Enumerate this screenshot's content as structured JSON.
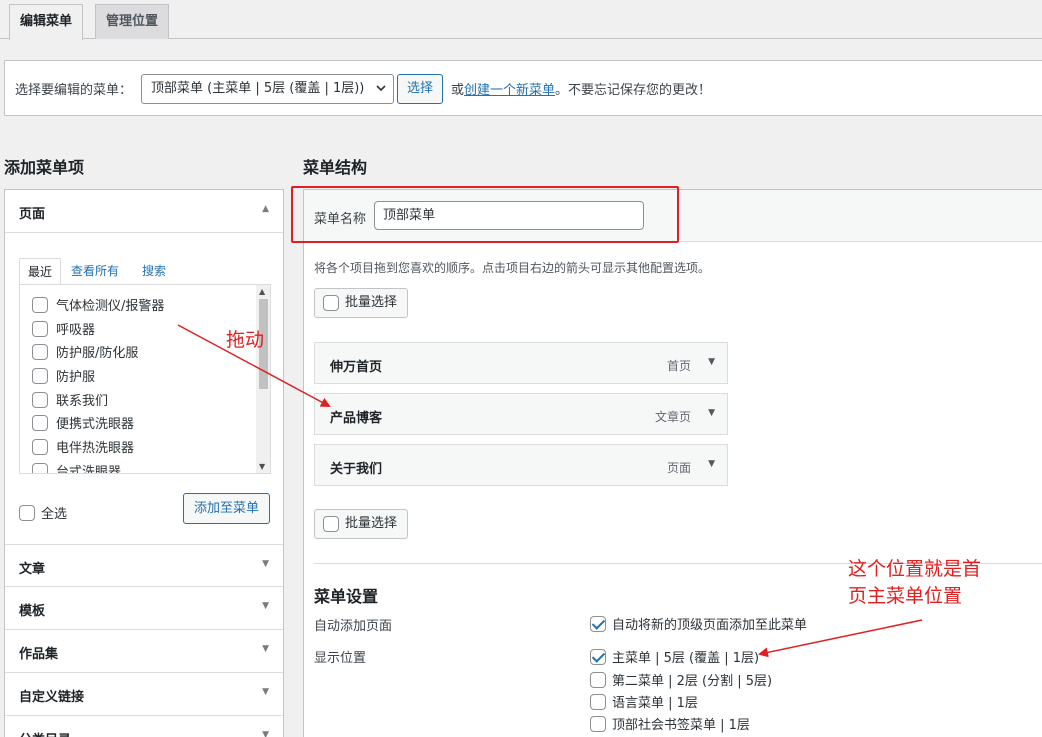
{
  "tabs": [
    {
      "label": "编辑菜单",
      "active": true
    },
    {
      "label": "管理位置",
      "active": false
    }
  ],
  "manage": {
    "label": "选择要编辑的菜单：",
    "selected_menu": "顶部菜单 (主菜单 | 5层 (覆盖 | 1层))",
    "select_button": "选择",
    "note_prefix": "或",
    "note_link": "创建一个新菜单",
    "note_suffix": "。不要忘记保存您的更改！"
  },
  "left": {
    "title": "添加菜单项",
    "pages_section": {
      "title": "页面",
      "subtabs": [
        "最近",
        "查看所有",
        "搜索"
      ],
      "items": [
        "气体检测仪/报警器",
        "呼吸器",
        "防护服/防化服",
        "防护服",
        "联系我们",
        "便携式洗眼器",
        "电伴热洗眼器",
        "台式洗眼器"
      ],
      "select_all": "全选",
      "add_button": "添加至菜单"
    },
    "sections": [
      "文章",
      "模板",
      "作品集",
      "自定义链接",
      "分类目录"
    ]
  },
  "right": {
    "title": "菜单结构",
    "name_label": "菜单名称",
    "name_value": "顶部菜单",
    "instruction": "将各个项目拖到您喜欢的顺序。点击项目右边的箭头可显示其他配置选项。",
    "bulk_select": "批量选择",
    "menu_items": [
      {
        "title": "伸万首页",
        "type": "首页"
      },
      {
        "title": "产品博客",
        "type": "文章页"
      },
      {
        "title": "关于我们",
        "type": "页面"
      }
    ],
    "settings": {
      "title": "菜单设置",
      "auto_add_label": "自动添加页面",
      "auto_add_option": "自动将新的顶级页面添加至此菜单",
      "location_label": "显示位置",
      "locations": [
        {
          "label": "主菜单 | 5层 (覆盖 | 1层)",
          "checked": true
        },
        {
          "label": "第二菜单 | 2层 (分割 | 5层)",
          "checked": false
        },
        {
          "label": "语言菜单 | 1层",
          "checked": false
        },
        {
          "label": "顶部社会书签菜单 | 1层",
          "checked": false
        }
      ]
    }
  },
  "annotations": {
    "drag": "拖动",
    "location_note_line1": "这个位置就是首",
    "location_note_line2": "页主菜单位置"
  },
  "colors": {
    "accent": "#2271b1",
    "annotation": "#e02020"
  }
}
